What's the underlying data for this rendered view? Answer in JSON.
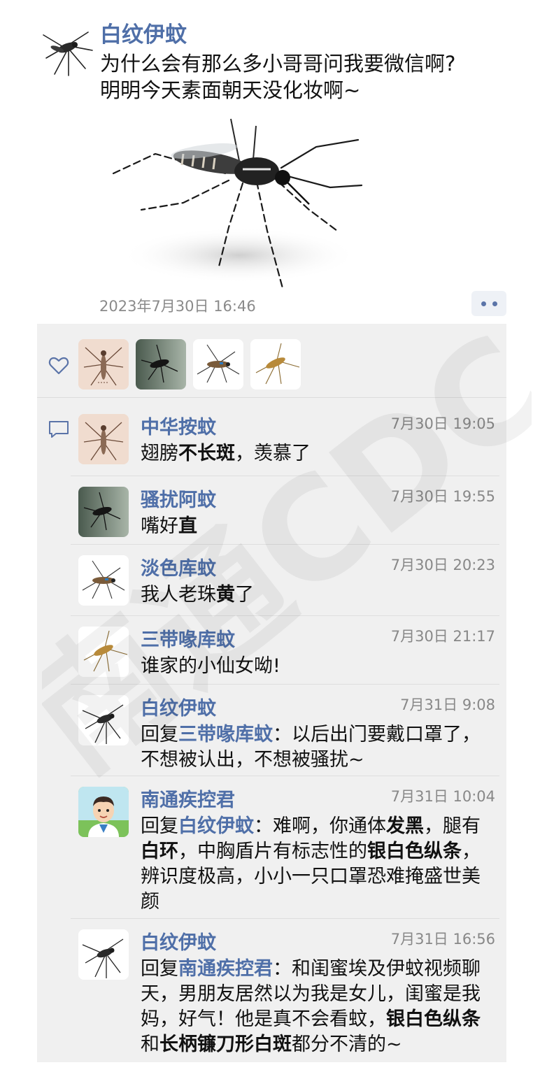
{
  "post": {
    "author": "白纹伊蚊",
    "text_line1": "为什么会有那么多小哥哥问我要微信啊?",
    "text_line2": "明明今天素面朝天没化妆啊~",
    "timestamp": "2023年7月30日 16:46"
  },
  "likes": {
    "icon": "heart-icon",
    "count_shown": 4
  },
  "comments": [
    {
      "author": "中华按蚊",
      "time": "7月30日 19:05",
      "parts": [
        {
          "t": "翅膀"
        },
        {
          "t": "不长斑",
          "b": true
        },
        {
          "t": "，羡慕了"
        }
      ]
    },
    {
      "author": "骚扰阿蚊",
      "time": "7月30日 19:55",
      "parts": [
        {
          "t": "嘴好"
        },
        {
          "t": "直",
          "b": true
        }
      ]
    },
    {
      "author": "淡色库蚊",
      "time": "7月30日 20:23",
      "parts": [
        {
          "t": "我人老珠"
        },
        {
          "t": "黄",
          "b": true
        },
        {
          "t": "了"
        }
      ]
    },
    {
      "author": "三带喙库蚊",
      "time": "7月30日 21:17",
      "parts": [
        {
          "t": "谁家的小仙女呦!"
        }
      ]
    },
    {
      "author": "白纹伊蚊",
      "time": "7月31日 9:08",
      "parts": [
        {
          "t": "回复"
        },
        {
          "t": "三带喙库蚊",
          "r": true
        },
        {
          "t": "：以后出门要戴口罩了，不想被认出，不想被骚扰~"
        }
      ]
    },
    {
      "author": "南通疾控君",
      "time": "7月31日 10:04",
      "parts": [
        {
          "t": "回复"
        },
        {
          "t": "白纹伊蚊",
          "r": true
        },
        {
          "t": "：难啊，你通体"
        },
        {
          "t": "发黑",
          "b": true
        },
        {
          "t": "，腿有"
        },
        {
          "t": "白环",
          "b": true
        },
        {
          "t": "，中胸盾片有标志性的"
        },
        {
          "t": "银白色纵条",
          "b": true
        },
        {
          "t": "，辨识度极高，小小一只口罩恐难掩盛世美颜"
        }
      ]
    },
    {
      "author": "白纹伊蚊",
      "time": "7月31日 16:56",
      "parts": [
        {
          "t": "回复"
        },
        {
          "t": "南通疾控君",
          "r": true
        },
        {
          "t": "：和闺蜜埃及伊蚊视频聊天，男朋友居然以为我是女儿，闺蜜是我妈，好气！他是真不会看蚊，"
        },
        {
          "t": "银白色纵条",
          "b": true
        },
        {
          "t": "和"
        },
        {
          "t": "长柄镰刀形白斑",
          "b": true
        },
        {
          "t": "都分不清的~"
        }
      ]
    }
  ],
  "watermark_text": "南通CDC",
  "colors": {
    "name_blue": "#4f6fa8",
    "feedback_bg": "#f0f0f0",
    "time_gray": "#8a8a8a"
  }
}
